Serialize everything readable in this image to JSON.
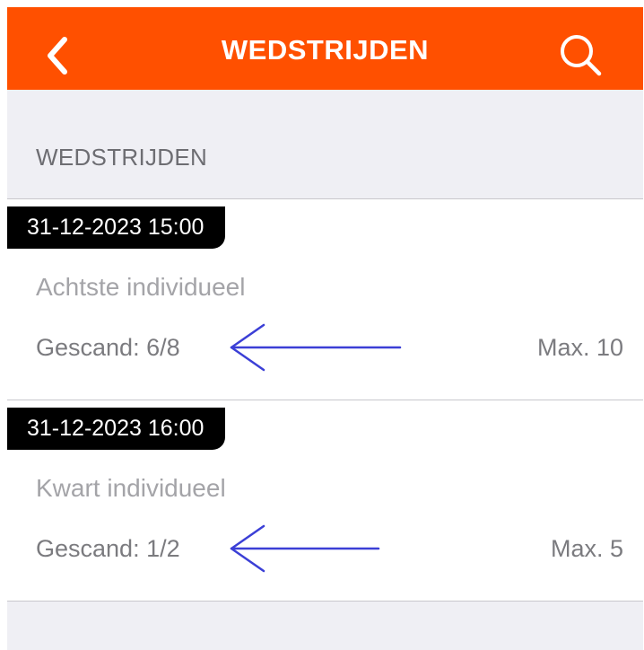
{
  "header": {
    "title": "WEDSTRIJDEN",
    "back_icon": "chevron-left-icon",
    "search_icon": "search-icon",
    "background": "#ff5000"
  },
  "section": {
    "title": "WEDSTRIJDEN"
  },
  "matches": [
    {
      "datetime": "31-12-2023  15:00",
      "name": "Achtste individueel",
      "scanned": "Gescand: 6/8",
      "max": "Max. 10"
    },
    {
      "datetime": "31-12-2023  16:00",
      "name": "Kwart individueel",
      "scanned": "Gescand: 1/2",
      "max": "Max. 5"
    }
  ],
  "annotation": {
    "arrow_icon": "arrow-left-icon",
    "color": "#3b3fd6"
  }
}
